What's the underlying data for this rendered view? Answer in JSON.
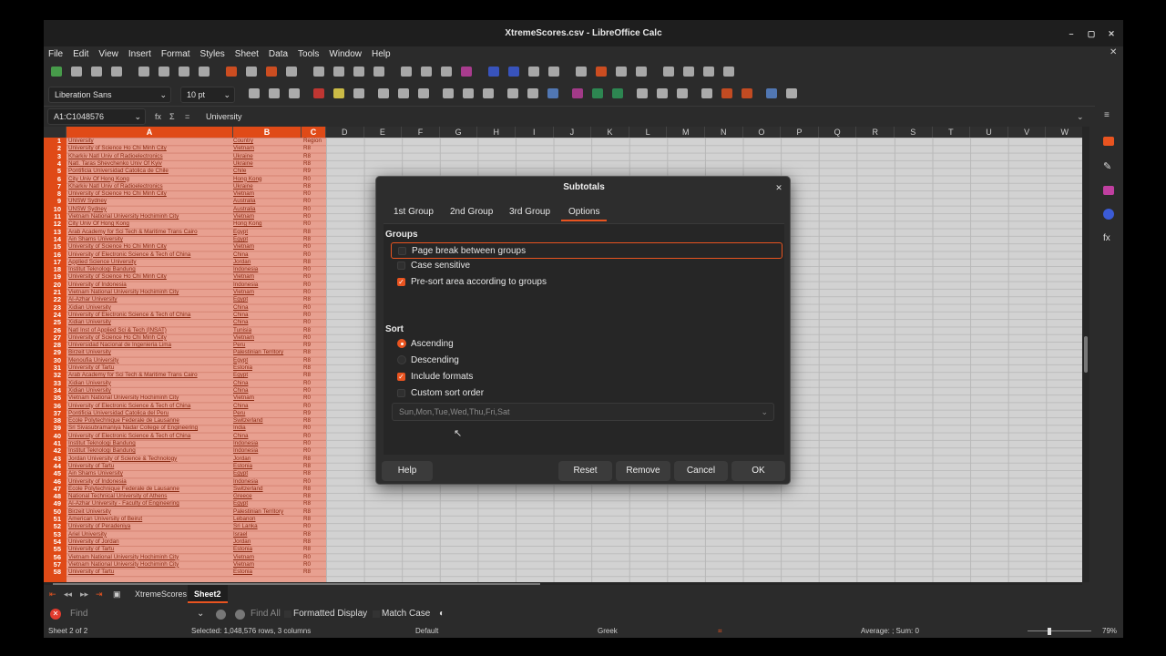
{
  "window": {
    "title": "XtremeScores.csv - LibreOffice Calc"
  },
  "menu": [
    "File",
    "Edit",
    "View",
    "Insert",
    "Format",
    "Styles",
    "Sheet",
    "Data",
    "Tools",
    "Window",
    "Help"
  ],
  "format_toolbar": {
    "font_name": "Liberation Sans",
    "font_size": "10 pt"
  },
  "formula_bar": {
    "name_box": "A1:C1048576",
    "content": "University"
  },
  "columns": [
    "A",
    "B",
    "C",
    "D",
    "E",
    "F",
    "G",
    "H",
    "I",
    "J",
    "K",
    "L",
    "M",
    "N",
    "O",
    "P",
    "Q",
    "R",
    "S",
    "T",
    "U",
    "V",
    "W"
  ],
  "rows": [
    {
      "n": "1",
      "u": "University",
      "c": "Country",
      "r": "Region"
    },
    {
      "n": "2",
      "u": "University of Science Ho Chi Minh City",
      "c": "Vietnam",
      "r": "R8"
    },
    {
      "n": "3",
      "u": "Kharkiv Natl Univ of Radioelectronics",
      "c": "Ukraine",
      "r": "R8"
    },
    {
      "n": "4",
      "u": "Natl. Taras Shevchenko Univ Of Kyiv",
      "c": "Ukraine",
      "r": "R8"
    },
    {
      "n": "5",
      "u": "Pontificia Universidad Catolica de Chile",
      "c": "Chile",
      "r": "R9"
    },
    {
      "n": "6",
      "u": "City Univ Of Hong Kong",
      "c": "Hong Kong",
      "r": "R0"
    },
    {
      "n": "7",
      "u": "Kharkiv Natl Univ of Radioelectronics",
      "c": "Ukraine",
      "r": "R8"
    },
    {
      "n": "8",
      "u": "University of Science Ho Chi Minh City",
      "c": "Vietnam",
      "r": "R0"
    },
    {
      "n": "9",
      "u": "UNSW Sydney",
      "c": "Australia",
      "r": "R0"
    },
    {
      "n": "10",
      "u": "UNSW Sydney",
      "c": "Australia",
      "r": "R0"
    },
    {
      "n": "11",
      "u": "Vietnam National University Hochiminh City",
      "c": "Vietnam",
      "r": "R0"
    },
    {
      "n": "12",
      "u": "City Univ Of Hong Kong",
      "c": "Hong Kong",
      "r": "R0"
    },
    {
      "n": "13",
      "u": "Arab Academy for Sci Tech & Maritime Trans Cairo",
      "c": "Egypt",
      "r": "R8"
    },
    {
      "n": "14",
      "u": "Ain Shams University",
      "c": "Egypt",
      "r": "R8"
    },
    {
      "n": "15",
      "u": "University of Science Ho Chi Minh City",
      "c": "Vietnam",
      "r": "R0"
    },
    {
      "n": "16",
      "u": "University of Electronic Science & Tech of China",
      "c": "China",
      "r": "R0"
    },
    {
      "n": "17",
      "u": "Applied Science University",
      "c": "Jordan",
      "r": "R8"
    },
    {
      "n": "18",
      "u": "Institut Teknologi Bandung",
      "c": "Indonesia",
      "r": "R0"
    },
    {
      "n": "19",
      "u": "University of Science Ho Chi Minh City",
      "c": "Vietnam",
      "r": "R0"
    },
    {
      "n": "20",
      "u": "University of Indonesia",
      "c": "Indonesia",
      "r": "R0"
    },
    {
      "n": "21",
      "u": "Vietnam National University Hochiminh City",
      "c": "Vietnam",
      "r": "R0"
    },
    {
      "n": "22",
      "u": "Al-Azhar University",
      "c": "Egypt",
      "r": "R8"
    },
    {
      "n": "23",
      "u": "Xidian University",
      "c": "China",
      "r": "R0"
    },
    {
      "n": "24",
      "u": "University of Electronic Science & Tech of China",
      "c": "China",
      "r": "R0"
    },
    {
      "n": "25",
      "u": "Xidian University",
      "c": "China",
      "r": "R0"
    },
    {
      "n": "26",
      "u": "Natl Inst of Applied Sci & Tech (INSAT)",
      "c": "Tunisia",
      "r": "R8"
    },
    {
      "n": "27",
      "u": "University of Science Ho Chi Minh City",
      "c": "Vietnam",
      "r": "R0"
    },
    {
      "n": "28",
      "u": "Universidad Nacional de Ingenieria Lima",
      "c": "Peru",
      "r": "R9"
    },
    {
      "n": "29",
      "u": "Birzeit University",
      "c": "Palestinian Territory",
      "r": "R8"
    },
    {
      "n": "30",
      "u": "Menoufia University",
      "c": "Egypt",
      "r": "R8"
    },
    {
      "n": "31",
      "u": "University of Tartu",
      "c": "Estonia",
      "r": "R8"
    },
    {
      "n": "32",
      "u": "Arab Academy for Sci Tech & Maritime Trans Cairo",
      "c": "Egypt",
      "r": "R8"
    },
    {
      "n": "33",
      "u": "Xidian University",
      "c": "China",
      "r": "R0"
    },
    {
      "n": "34",
      "u": "Xidian University",
      "c": "China",
      "r": "R0"
    },
    {
      "n": "35",
      "u": "Vietnam National University Hochiminh City",
      "c": "Vietnam",
      "r": "R0"
    },
    {
      "n": "36",
      "u": "University of Electronic Science & Tech of China",
      "c": "China",
      "r": "R0"
    },
    {
      "n": "37",
      "u": "Pontificia Universidad Catolica del Peru",
      "c": "Peru",
      "r": "R9"
    },
    {
      "n": "38",
      "u": "Ecole Polytechnique Federale de Lausanne",
      "c": "Switzerland",
      "r": "R8"
    },
    {
      "n": "39",
      "u": "Sri Sivasubramaniya Nadar College of Engineering",
      "c": "India",
      "r": "R0"
    },
    {
      "n": "40",
      "u": "University of Electronic Science & Tech of China",
      "c": "China",
      "r": "R0"
    },
    {
      "n": "41",
      "u": "Institut Teknologi Bandung",
      "c": "Indonesia",
      "r": "R0"
    },
    {
      "n": "42",
      "u": "Institut Teknologi Bandung",
      "c": "Indonesia",
      "r": "R0"
    },
    {
      "n": "43",
      "u": "Jordan University of Science & Technology",
      "c": "Jordan",
      "r": "R8"
    },
    {
      "n": "44",
      "u": "University of Tartu",
      "c": "Estonia",
      "r": "R8"
    },
    {
      "n": "45",
      "u": "Ain Shams University",
      "c": "Egypt",
      "r": "R8"
    },
    {
      "n": "46",
      "u": "University of Indonesia",
      "c": "Indonesia",
      "r": "R0"
    },
    {
      "n": "47",
      "u": "Ecole Polytechnique Federale de Lausanne",
      "c": "Switzerland",
      "r": "R8"
    },
    {
      "n": "48",
      "u": "National Technical University of Athens",
      "c": "Greece",
      "r": "R8"
    },
    {
      "n": "49",
      "u": "Al-Azhar University - Faculty of Engineering",
      "c": "Egypt",
      "r": "R8"
    },
    {
      "n": "50",
      "u": "Birzeit University",
      "c": "Palestinian Territory",
      "r": "R8"
    },
    {
      "n": "51",
      "u": "American University of Beirut",
      "c": "Lebanon",
      "r": "R8"
    },
    {
      "n": "52",
      "u": "University of Peradeniya",
      "c": "Sri Lanka",
      "r": "R0"
    },
    {
      "n": "53",
      "u": "Ariel University",
      "c": "Israel",
      "r": "R8"
    },
    {
      "n": "54",
      "u": "University of Jordan",
      "c": "Jordan",
      "r": "R8"
    },
    {
      "n": "55",
      "u": "University of Tartu",
      "c": "Estonia",
      "r": "R8"
    },
    {
      "n": "56",
      "u": "Vietnam National University Hochiminh City",
      "c": "Vietnam",
      "r": "R0"
    },
    {
      "n": "57",
      "u": "Vietnam National University Hochiminh City",
      "c": "Vietnam",
      "r": "R0"
    },
    {
      "n": "58",
      "u": "University of Tartu",
      "c": "Estonia",
      "r": "R8"
    }
  ],
  "sheet_tabs": [
    "XtremeScores",
    "Sheet2"
  ],
  "active_sheet": "Sheet2",
  "find": {
    "placeholder": "Find",
    "find_all": "Find All",
    "formatted_display": "Formatted Display",
    "match_case": "Match Case"
  },
  "status": {
    "sheet": "Sheet 2 of 2",
    "selection": "Selected: 1,048,576 rows, 3 columns",
    "style": "Default",
    "language": "Greek",
    "summary": "Average: ; Sum: 0",
    "zoom": "79%"
  },
  "dialog": {
    "title": "Subtotals",
    "tabs": [
      "1st Group",
      "2nd Group",
      "3rd Group",
      "Options"
    ],
    "active_tab": "Options",
    "groups_heading": "Groups",
    "groups_options": [
      {
        "label": "Page break between groups",
        "checked": false
      },
      {
        "label": "Case sensitive",
        "checked": false
      },
      {
        "label": "Pre-sort area according to groups",
        "checked": true
      }
    ],
    "sort_heading": "Sort",
    "ascending": "Ascending",
    "descending": "Descending",
    "sort_selected": "Ascending",
    "include_formats": "Include formats",
    "custom_sort_order": "Custom sort order",
    "custom_sort_value": "Sun,Mon,Tue,Wed,Thu,Fri,Sat",
    "buttons": {
      "help": "Help",
      "reset": "Reset",
      "remove": "Remove",
      "cancel": "Cancel",
      "ok": "OK"
    }
  },
  "colors": {
    "accent": "#e95420",
    "selection": "#e8a090",
    "bg": "#2b2b2b"
  }
}
